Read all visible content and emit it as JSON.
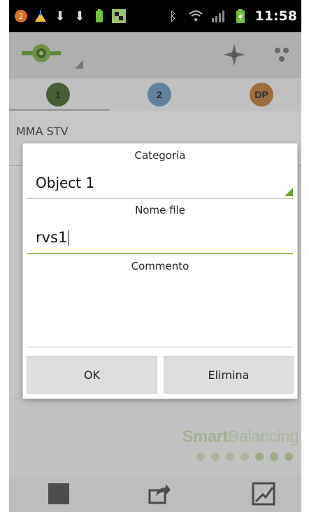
{
  "status_bar": {
    "time": "11:58",
    "icons": [
      "notification-badge-icon",
      "cleaner-icon",
      "download-icon",
      "download-icon",
      "battery-app-icon",
      "chess-icon",
      "bluetooth-icon",
      "wifi-icon",
      "signal-icon",
      "battery-icon"
    ]
  },
  "toolbar": {
    "logo_icon": "balancer-logo-icon",
    "icons": [
      "rotor-icon",
      "drops-icon"
    ]
  },
  "tabs": [
    {
      "label": "1",
      "color": "#3f5a2a"
    },
    {
      "label": "2",
      "color": "#5f86a8"
    },
    {
      "label": "DP",
      "color": "#a66e34"
    }
  ],
  "content": {
    "row_label": "MMA STV"
  },
  "dialog": {
    "category_label": "Categoria",
    "category_value": "Object 1",
    "filename_label": "Nome file",
    "filename_value": "rvs1",
    "comment_label": "Commento",
    "comment_value": "",
    "ok_button": "OK",
    "delete_button": "Elimina"
  },
  "brand": {
    "part1": "Smart",
    "part2": "Balancing",
    "dots_total": 7,
    "dots_active": 3
  },
  "colors": {
    "accent_green": "#8fbd4e",
    "brand_green": "#a6ba90"
  }
}
